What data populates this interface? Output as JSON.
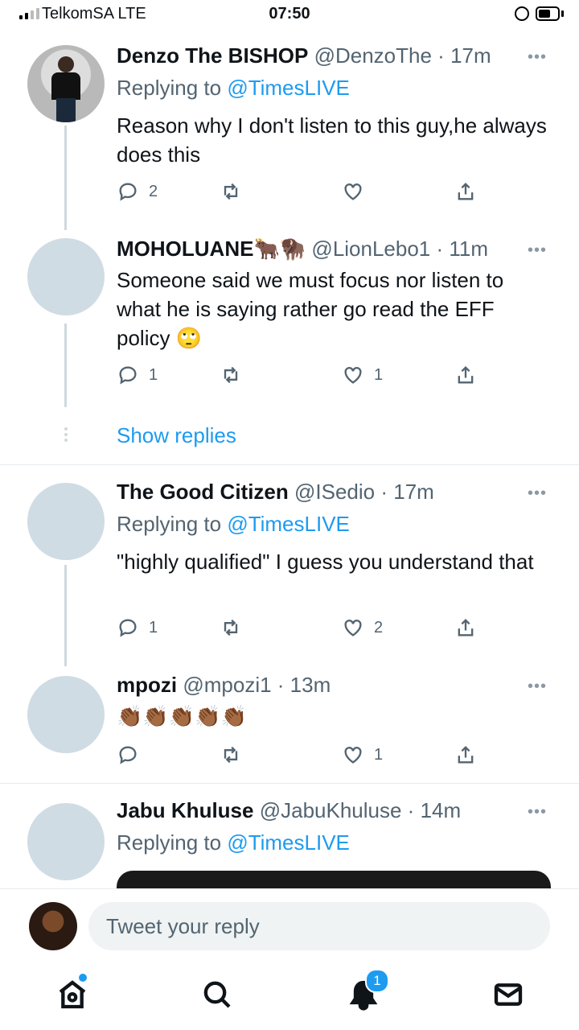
{
  "status_bar": {
    "carrier": "TelkomSA  LTE",
    "time": "07:50"
  },
  "tweets": [
    {
      "name": "Denzo The BISHOP",
      "handle": "@DenzoThe",
      "time": "17m",
      "replying_to_prefix": "Replying to ",
      "replying_to": "@TimesLIVE",
      "text": "Reason why I don't listen to this guy,he always does this",
      "replies": "2",
      "retweets": "",
      "likes": ""
    },
    {
      "name": "MOHOLUANE",
      "name_emoji": "🐂🦬",
      "handle": "@LionLebo1",
      "time": "11m",
      "text": "Someone said we must focus nor listen to what he is saying rather go read the EFF policy",
      "text_emoji": "🙄",
      "replies": "1",
      "retweets": "",
      "likes": "1"
    },
    {
      "name": "The Good Citizen",
      "handle": "@ISedio",
      "time": "17m",
      "replying_to_prefix": "Replying to ",
      "replying_to": "@TimesLIVE",
      "text": "\"highly qualified\" I guess you understand that",
      "replies": "1",
      "retweets": "",
      "likes": "2"
    },
    {
      "name": "mpozi",
      "handle": "@mpozi1",
      "time": "13m",
      "text": "👏🏾👏🏾👏🏾👏🏾👏🏾",
      "replies": "",
      "retweets": "",
      "likes": "1"
    },
    {
      "name": "Jabu Khuluse",
      "handle": "@JabuKhuluse",
      "time": "14m",
      "replying_to_prefix": "Replying to ",
      "replying_to": "@TimesLIVE"
    }
  ],
  "show_replies": "Show replies",
  "more_glyph": "•••",
  "time_sep": " · ",
  "composer": {
    "placeholder": "Tweet your reply"
  },
  "tabbar": {
    "notifications_badge": "1"
  },
  "colors": {
    "accent": "#1d9bf0",
    "secondary_text": "#536471",
    "avatar_placeholder": "#d0dce4"
  }
}
